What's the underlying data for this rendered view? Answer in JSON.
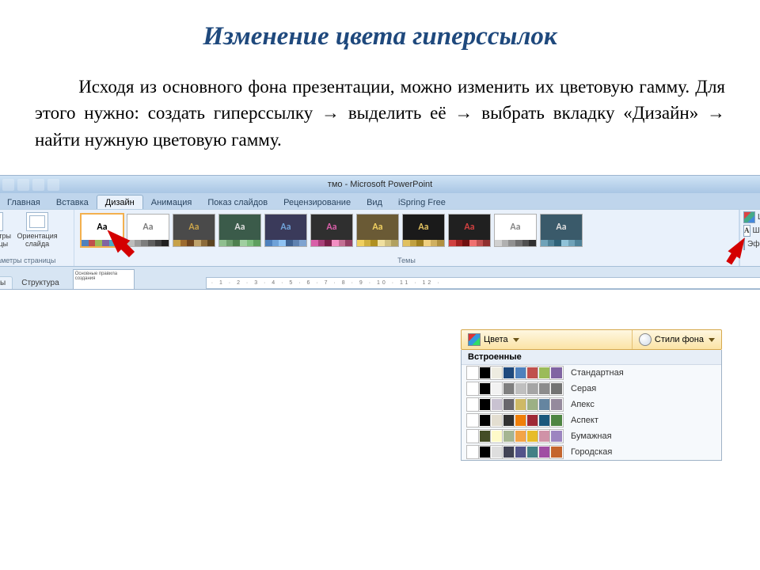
{
  "title": "Изменение цвета гиперссылок",
  "body_html": "Исходя из основного фона презентации, можно изменить их цветовую гамму. Для этого нужно: создать гиперссылку → выделить её → выбрать вкладку «Дизайн» → найти нужную цветовую гамму.",
  "shot": {
    "doc_title": "тмо - Microsoft PowerPoint",
    "tabs": [
      "Главная",
      "Вставка",
      "Дизайн",
      "Анимация",
      "Показ слайдов",
      "Рецензирование",
      "Вид",
      "iSpring Free"
    ],
    "active_tab": 2,
    "page_setup": {
      "btn1": "Параметры страницы",
      "btn2": "Ориентация слайда",
      "label": "Параметры страницы"
    },
    "themes_label": "Темы",
    "right_panel": {
      "colors": "Цвета",
      "fonts": "Шрифты",
      "effects": "Эффекты"
    },
    "pane_tabs": [
      "Слайды",
      "Структура"
    ],
    "thumb_caption": "Основные правила создания",
    "ruler": "· 1 · 2 · 3 · 4 · 5 · 6 · 7 · 8 · 9 · 10 · 11 · 12 ·",
    "theme_variants": [
      {
        "bg": "#ffffff",
        "fg": "#000",
        "sw": [
          "#4f81bd",
          "#c0504d",
          "#9bbb59",
          "#8064a2",
          "#4bacc6",
          "#f79646"
        ]
      },
      {
        "bg": "#ffffff",
        "fg": "#7f7f7f",
        "sw": [
          "#bcbcbc",
          "#9c9c9c",
          "#7d7d7d",
          "#5e5e5e",
          "#3f3f3f",
          "#202020"
        ]
      },
      {
        "bg": "#4a4a4a",
        "fg": "#c7a24a",
        "sw": [
          "#c7a24a",
          "#9c6b30",
          "#6e4520",
          "#bfa26b",
          "#8c6b3a",
          "#5c4420"
        ]
      },
      {
        "bg": "#3b5b4a",
        "fg": "#dedede",
        "sw": [
          "#8fbf8f",
          "#6fa06f",
          "#4f804f",
          "#a0cfa0",
          "#7fbf7f",
          "#5f9f5f"
        ]
      },
      {
        "bg": "#3a3a5a",
        "fg": "#6fa2d8",
        "sw": [
          "#4f81bd",
          "#6fa2d8",
          "#8fc3f3",
          "#3f6190",
          "#5f82b0",
          "#7fa3d0"
        ]
      },
      {
        "bg": "#2f2f2f",
        "fg": "#d85fa8",
        "sw": [
          "#d85fa8",
          "#a83f78",
          "#781f48",
          "#f38fc3",
          "#c36f93",
          "#933f63"
        ]
      },
      {
        "bg": "#6a5a35",
        "fg": "#f0d060",
        "sw": [
          "#f0d060",
          "#d0b040",
          "#b09020",
          "#f0e0a0",
          "#d0c080",
          "#b0a060"
        ]
      },
      {
        "bg": "#1a1a1a",
        "fg": "#e0c060",
        "sw": [
          "#e0c060",
          "#c0a040",
          "#a08020",
          "#f0d080",
          "#d0b060",
          "#b09040"
        ]
      },
      {
        "bg": "#202020",
        "fg": "#d04040",
        "sw": [
          "#d04040",
          "#a02020",
          "#701010",
          "#f07070",
          "#c05050",
          "#903030"
        ]
      },
      {
        "bg": "#ffffff",
        "fg": "#888",
        "sw": [
          "#d0d0d0",
          "#b0b0b0",
          "#909090",
          "#707070",
          "#505050",
          "#303030"
        ]
      },
      {
        "bg": "#3a5a6a",
        "fg": "#dedede",
        "sw": [
          "#6fa2b8",
          "#4f8298",
          "#2f6278",
          "#8fc2d8",
          "#6fa2b8",
          "#4f8298"
        ]
      }
    ]
  },
  "dropdown": {
    "colors_btn": "Цвета",
    "styles_btn": "Стили фона",
    "section": "Встроенные",
    "schemes": [
      {
        "name": "Стандартная",
        "c": [
          "#ffffff",
          "#000000",
          "#eeece1",
          "#1f497d",
          "#4f81bd",
          "#c0504d",
          "#9bbb59",
          "#8064a2"
        ]
      },
      {
        "name": "Серая",
        "c": [
          "#ffffff",
          "#000000",
          "#f2f2f2",
          "#7f7f7f",
          "#bfbfbf",
          "#a5a5a5",
          "#8c8c8c",
          "#737373"
        ]
      },
      {
        "name": "Апекс",
        "c": [
          "#ffffff",
          "#000000",
          "#c9c2d1",
          "#69676d",
          "#ceb966",
          "#9cb084",
          "#6585a0",
          "#958a9d"
        ]
      },
      {
        "name": "Аспект",
        "c": [
          "#ffffff",
          "#000000",
          "#e3ded1",
          "#323232",
          "#f07f09",
          "#9f2936",
          "#1b587c",
          "#4e8542"
        ]
      },
      {
        "name": "Бумажная",
        "c": [
          "#ffffff",
          "#444d26",
          "#fefac9",
          "#a5b592",
          "#f3a447",
          "#e7bc29",
          "#d092a7",
          "#9c85c0"
        ]
      },
      {
        "name": "Городская",
        "c": [
          "#ffffff",
          "#000000",
          "#dedede",
          "#424456",
          "#53548a",
          "#438086",
          "#a04da3",
          "#c4652d"
        ]
      }
    ]
  }
}
